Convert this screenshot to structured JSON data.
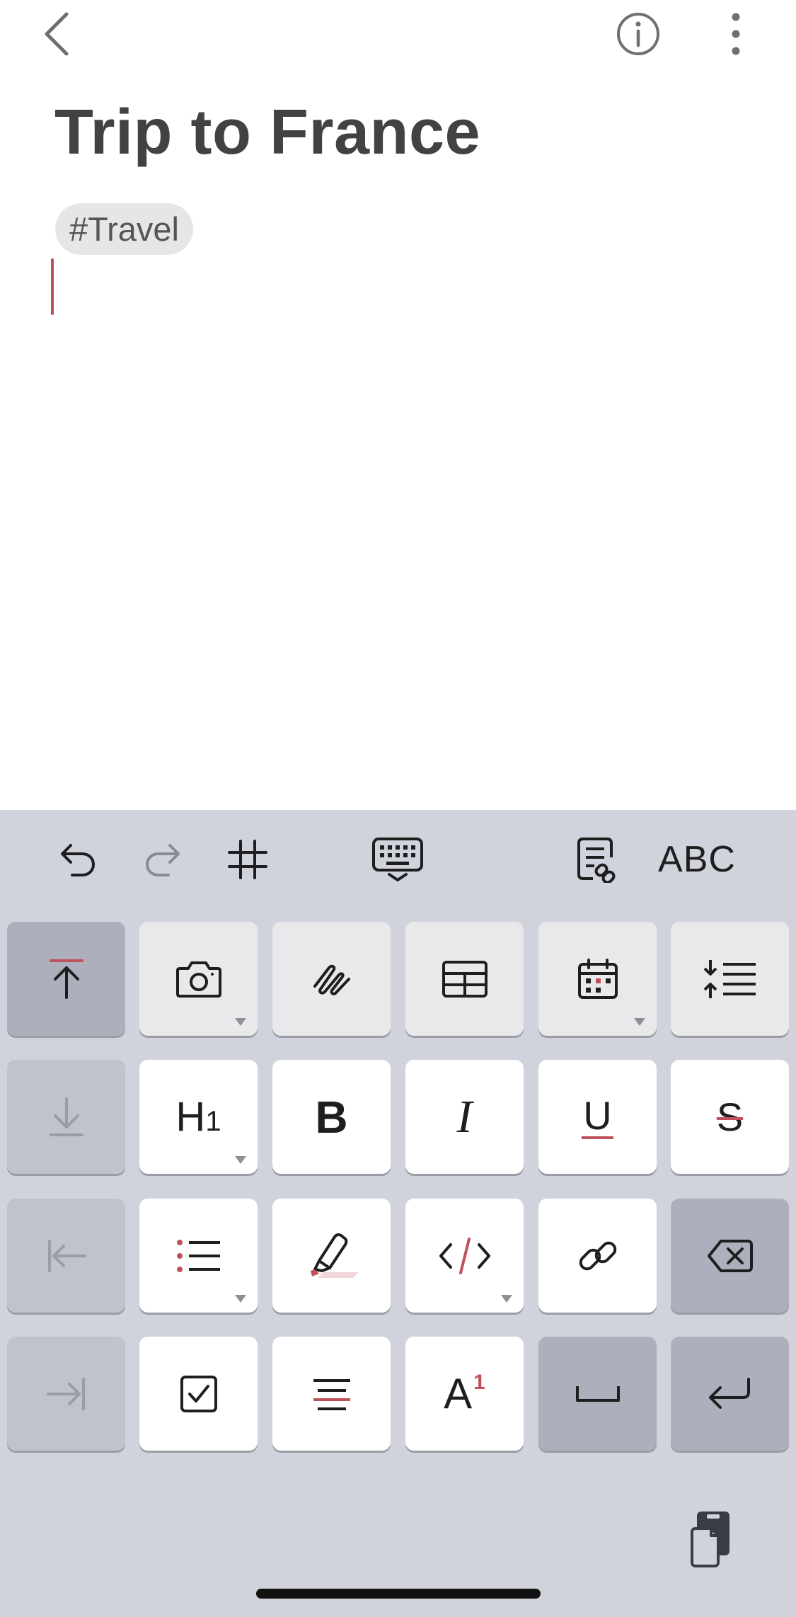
{
  "header": {
    "back_icon": "chevron-left-icon",
    "info_icon": "info-icon",
    "more_icon": "more-vertical-icon"
  },
  "note": {
    "title": "Trip to France",
    "tag": "#Travel"
  },
  "toolbar": {
    "abc_label": "ABC",
    "items": [
      "undo-icon",
      "redo-icon",
      "hashtag-icon",
      "keyboard-icon",
      "note-link-icon",
      "abc-button"
    ]
  },
  "keys": {
    "heading_label": "H1",
    "bold_label": "B",
    "italic_label": "I",
    "underline_label": "U",
    "strikethrough_label": "S",
    "superscript_label": "A",
    "superscript_digit": "1"
  },
  "colors": {
    "accent": "#c0515b",
    "keyboard_bg": "#d1d3dc",
    "title_text": "#424242"
  }
}
